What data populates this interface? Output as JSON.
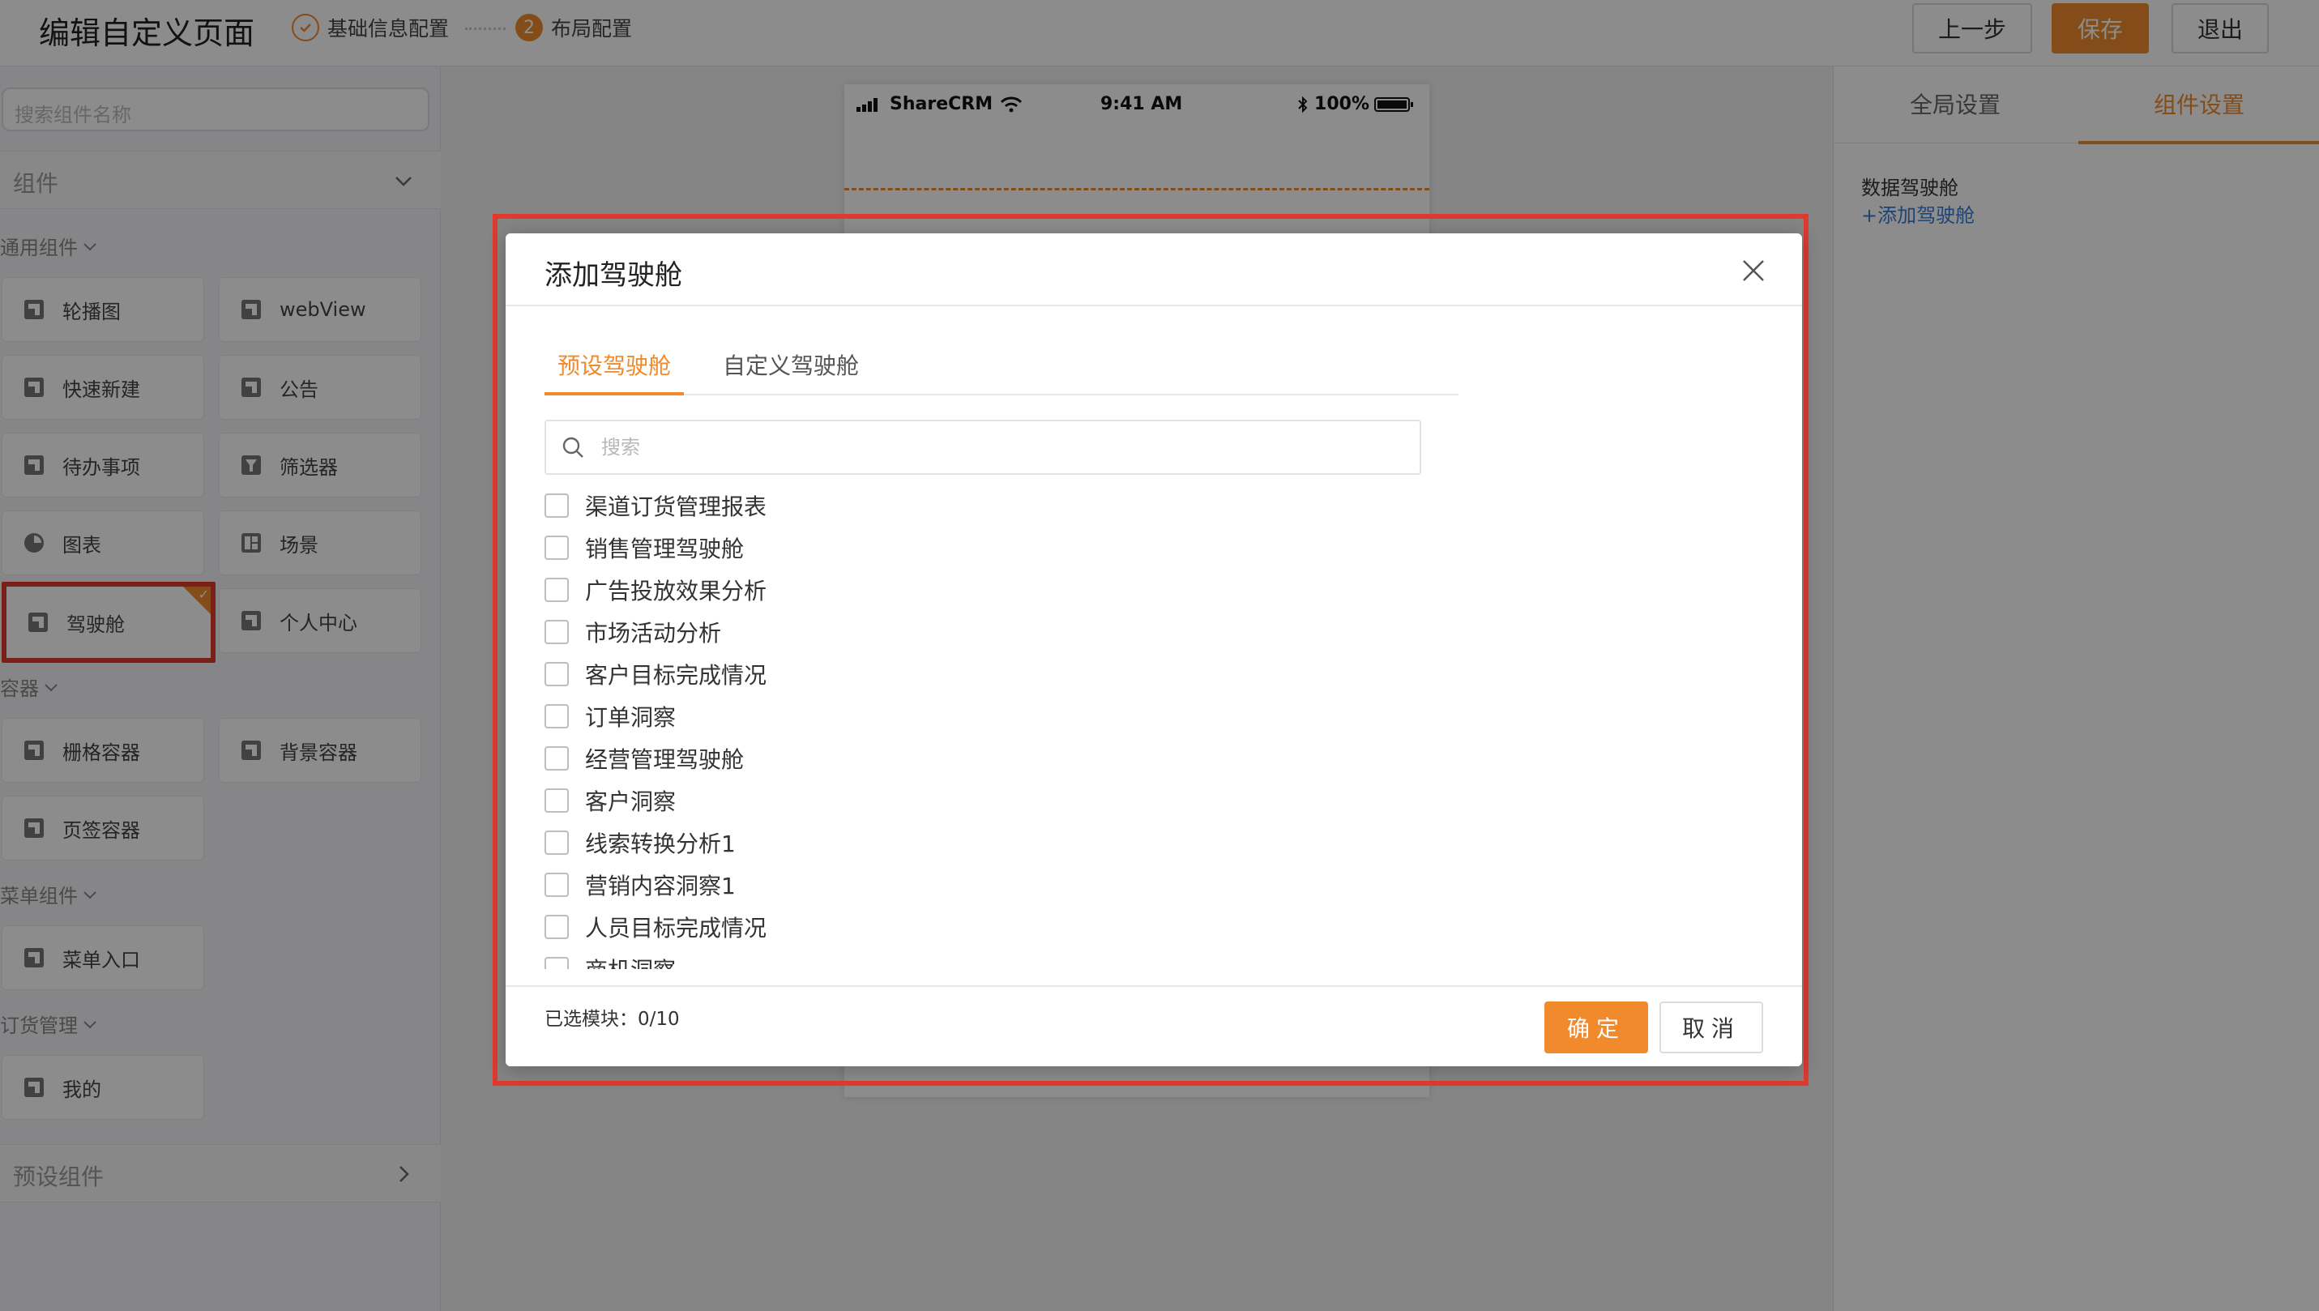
{
  "header": {
    "title": "编辑自定义页面",
    "steps": [
      {
        "label": "基础信息配置"
      },
      {
        "number": "2",
        "label": "布局配置"
      }
    ],
    "buttons": {
      "prev": "上一步",
      "save": "保存",
      "exit": "退出"
    }
  },
  "left": {
    "search_placeholder": "搜索组件名称",
    "components_header": "组件",
    "groups": [
      {
        "label": "通用组件",
        "items": [
          "轮播图",
          "webView",
          "快速新建",
          "公告",
          "待办事项",
          "筛选器",
          "图表",
          "场景",
          "驾驶舱",
          "个人中心"
        ]
      },
      {
        "label": "容器",
        "items": [
          "栅格容器",
          "背景容器",
          "页签容器"
        ]
      },
      {
        "label": "菜单组件",
        "items": [
          "菜单入口"
        ]
      },
      {
        "label": "订货管理",
        "items": [
          "我的"
        ]
      }
    ],
    "preset_header": "预设组件"
  },
  "phone": {
    "carrier": "ShareCRM",
    "time": "9:41 AM",
    "battery": "100%"
  },
  "right": {
    "tabs": {
      "global": "全局设置",
      "component": "组件设置"
    },
    "section_title": "数据驾驶舱",
    "add_link": "+添加驾驶舱"
  },
  "modal": {
    "title": "添加驾驶舱",
    "tabs": {
      "preset": "预设驾驶舱",
      "custom": "自定义驾驶舱"
    },
    "search_placeholder": "搜索",
    "items": [
      "渠道订货管理报表",
      "销售管理驾驶舱",
      "广告投放效果分析",
      "市场活动分析",
      "客户目标完成情况",
      "订单洞察",
      "经营管理驾驶舱",
      "客户洞察",
      "线索转换分析1",
      "营销内容洞察1",
      "人员目标完成情况",
      "商机洞察"
    ],
    "selected_label": "已选模块：",
    "selected_count": "0/10",
    "ok": "确定",
    "cancel": "取消"
  },
  "colors": {
    "accent": "#f08a2c",
    "highlight": "#e03a2e",
    "link": "#3a7bd5"
  }
}
